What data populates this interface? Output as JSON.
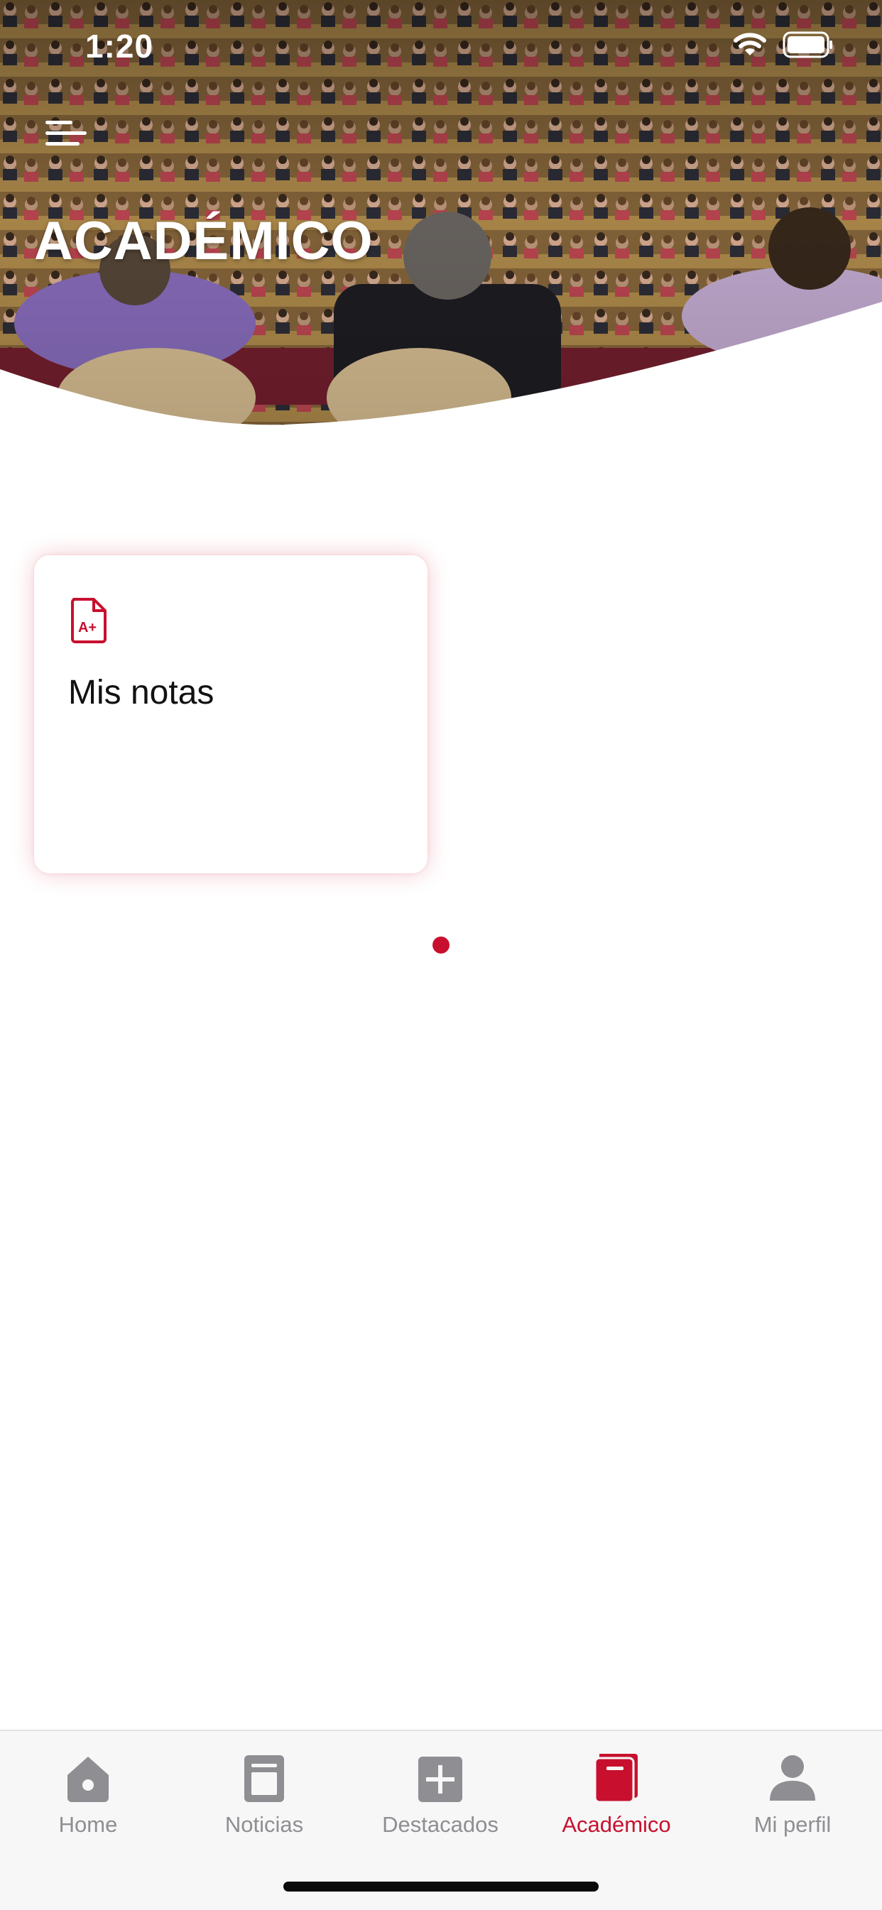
{
  "status_bar": {
    "time": "1:20",
    "wifi_icon": "wifi-icon",
    "battery_icon": "battery-icon"
  },
  "header": {
    "title": "ACADÉMICO",
    "menu_icon": "menu-icon"
  },
  "cards": [
    {
      "label": "Mis notas",
      "icon": "grade-document-icon",
      "icon_text": "A+"
    }
  ],
  "pagination": {
    "pages": 1,
    "current": 1
  },
  "tabbar": {
    "tabs": [
      {
        "label": "Home",
        "icon": "home-icon",
        "active": false
      },
      {
        "label": "Noticias",
        "icon": "news-icon",
        "active": false
      },
      {
        "label": "Destacados",
        "icon": "plus-square-icon",
        "active": false
      },
      {
        "label": "Académico",
        "icon": "book-icon",
        "active": true
      },
      {
        "label": "Mi perfil",
        "icon": "person-icon",
        "active": false
      }
    ]
  },
  "colors": {
    "accent": "#c8102e",
    "inactive": "#8e8e93",
    "tabbar_bg": "#f7f7f7"
  }
}
